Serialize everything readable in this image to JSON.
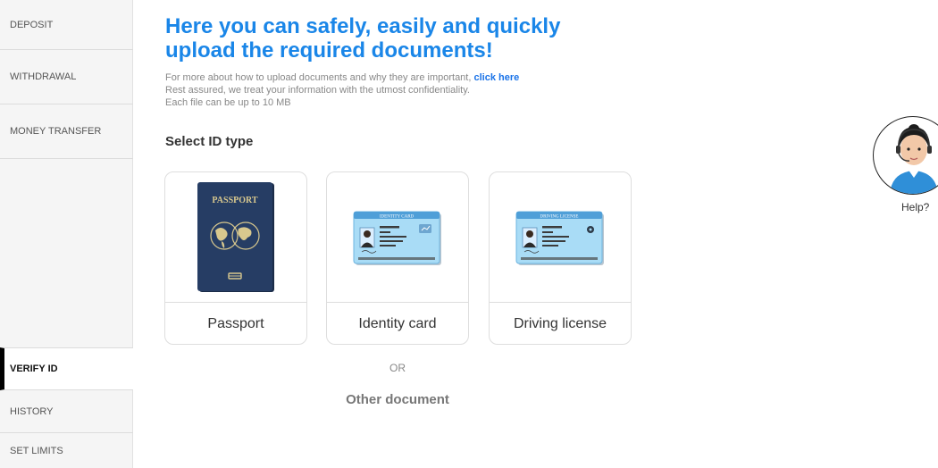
{
  "sidebar": {
    "items": [
      {
        "label": "DEPOSIT"
      },
      {
        "label": "WITHDRAWAL"
      },
      {
        "label": "MONEY TRANSFER"
      },
      {
        "label": "VERIFY ID"
      },
      {
        "label": "HISTORY"
      },
      {
        "label": "SET LIMITS"
      }
    ],
    "active": "VERIFY ID"
  },
  "main": {
    "title": "Here you can safely, easily and quickly upload the required documents!",
    "info_line1": "For more about how to upload documents and why they are important, ",
    "info_link": "click here",
    "info_line2": "Rest assured, we treat your information with the utmost confidentiality.",
    "info_line3": "Each file can be up to 10 MB",
    "select_title": "Select ID type",
    "cards": [
      {
        "label": "Passport",
        "image_text": "PASSPORT",
        "icon": "passport-icon"
      },
      {
        "label": "Identity card",
        "image_text": "IDENTITY CARD",
        "icon": "identity-card-icon"
      },
      {
        "label": "Driving license",
        "image_text": "DRIVING LICENSE",
        "icon": "driving-license-icon"
      }
    ],
    "or_text": "OR",
    "other_document": "Other document"
  },
  "help": {
    "label": "Help?",
    "icon": "support-agent-icon"
  },
  "colors": {
    "accent": "#1a86e8",
    "passport": "#243a5e",
    "card_blue": "#8ecdf0"
  }
}
